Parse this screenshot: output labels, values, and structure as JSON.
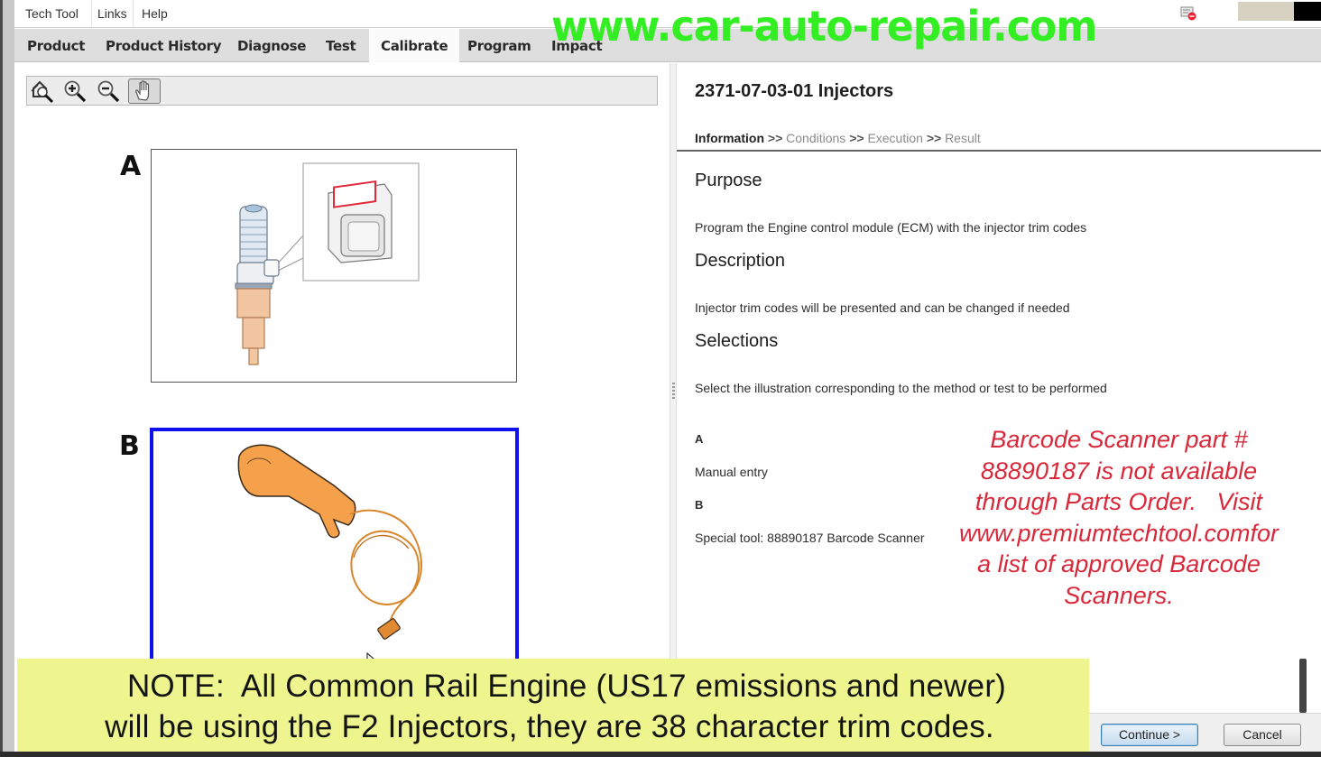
{
  "menubar": {
    "items": [
      "Tech Tool",
      "Links",
      "Help"
    ]
  },
  "tabs": [
    {
      "label": "Product",
      "active": false
    },
    {
      "label": "Product History",
      "active": false
    },
    {
      "label": "Diagnose",
      "active": false
    },
    {
      "label": "Test",
      "active": false
    },
    {
      "label": "Calibrate",
      "active": true
    },
    {
      "label": "Program",
      "active": false
    },
    {
      "label": "Impact",
      "active": false
    }
  ],
  "watermark": "www.car-auto-repair.com",
  "viewer_toolbar": {
    "tools": [
      "fit-to-window-icon",
      "zoom-in-icon",
      "zoom-out-icon",
      "pan-hand-icon"
    ],
    "selected_tool": "pan-hand-icon"
  },
  "illustrations": [
    {
      "label": "A",
      "selected": false,
      "depicts": "injector with trim code label closeup"
    },
    {
      "label": "B",
      "selected": true,
      "depicts": "barcode scanner with cable"
    }
  ],
  "procedure": {
    "title": "2371-07-03-01 Injectors",
    "steps": [
      "Information",
      "Conditions",
      "Execution",
      "Result"
    ],
    "current_step": "Information",
    "step_separator": ">>",
    "purpose_heading": "Purpose",
    "purpose_text": "Program the Engine control module (ECM) with the injector trim codes",
    "description_heading": "Description",
    "description_text": "Injector trim codes will be presented and can be changed if needed",
    "selections_heading": "Selections",
    "selections_text": "Select the illustration corresponding to the method or test to be performed",
    "selections": [
      {
        "label": "A",
        "text": "Manual entry"
      },
      {
        "label": "B",
        "text": "Special tool: 88890187 Barcode Scanner"
      }
    ]
  },
  "annotation_red": [
    "Barcode Scanner part #",
    "88890187 is not available",
    "through Parts Order.   Visit",
    "www.premiumtechtool.comfor",
    "a list of approved Barcode",
    "Scanners."
  ],
  "buttons": {
    "continue": "Continue >",
    "cancel": "Cancel"
  },
  "note_banner": {
    "line1": "NOTE:  All Common Rail Engine (US17 emissions and newer)",
    "line2": "will be using the F2 Injectors, they are 38 character trim codes."
  },
  "colors": {
    "watermark": "#33ee22",
    "selection_border": "#1010ee",
    "annotation": "#d8283a",
    "note_background": "#eef58e"
  }
}
